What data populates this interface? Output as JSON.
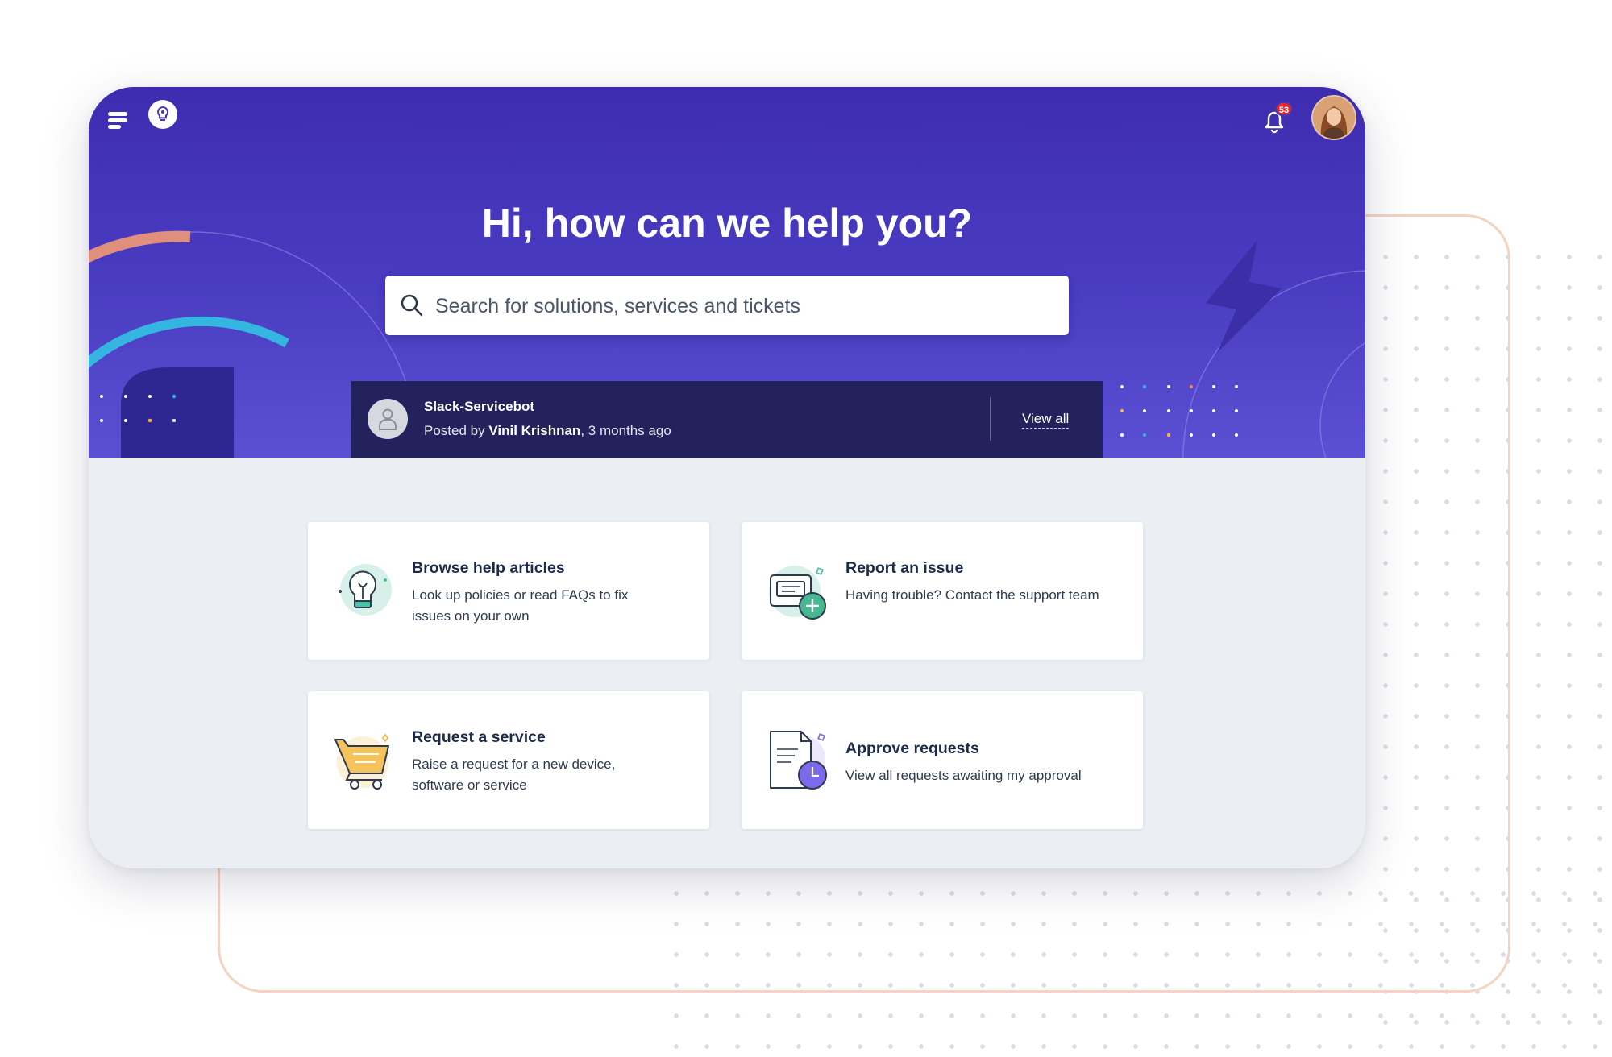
{
  "header": {
    "menu_icon": "hamburger-menu-icon",
    "logo_icon": "lightbulb-logo-icon",
    "notifications": {
      "icon": "bell-icon",
      "count": "53"
    },
    "avatar_icon": "user-avatar"
  },
  "hero": {
    "title": "Hi, how can we help you?"
  },
  "search": {
    "icon": "search-icon",
    "placeholder": "Search for solutions, services and tickets"
  },
  "announcement": {
    "title": "Slack-Servicebot",
    "posted_prefix": "Posted by ",
    "author": "Vinil Krishnan",
    "time": ", 3 months ago",
    "view_all": "View all"
  },
  "cards": [
    {
      "title": "Browse help articles",
      "description": "Look up policies or read FAQs to fix issues on your own",
      "icon": "lightbulb-icon"
    },
    {
      "title": "Report an issue",
      "description": "Having trouble? Contact the support team",
      "icon": "report-issue-icon"
    },
    {
      "title": "Request a service",
      "description": "Raise a request for a new device, software or service",
      "icon": "shopping-cart-icon"
    },
    {
      "title": "Approve requests",
      "description": "View all requests awaiting my approval",
      "icon": "document-clock-icon"
    }
  ],
  "colors": {
    "hero_top": "#3e2cb0",
    "hero_bottom": "#5b4fd3",
    "announcement_bg": "#23225c",
    "page_bg": "#ebeef2",
    "badge_red": "#e02a2a"
  }
}
